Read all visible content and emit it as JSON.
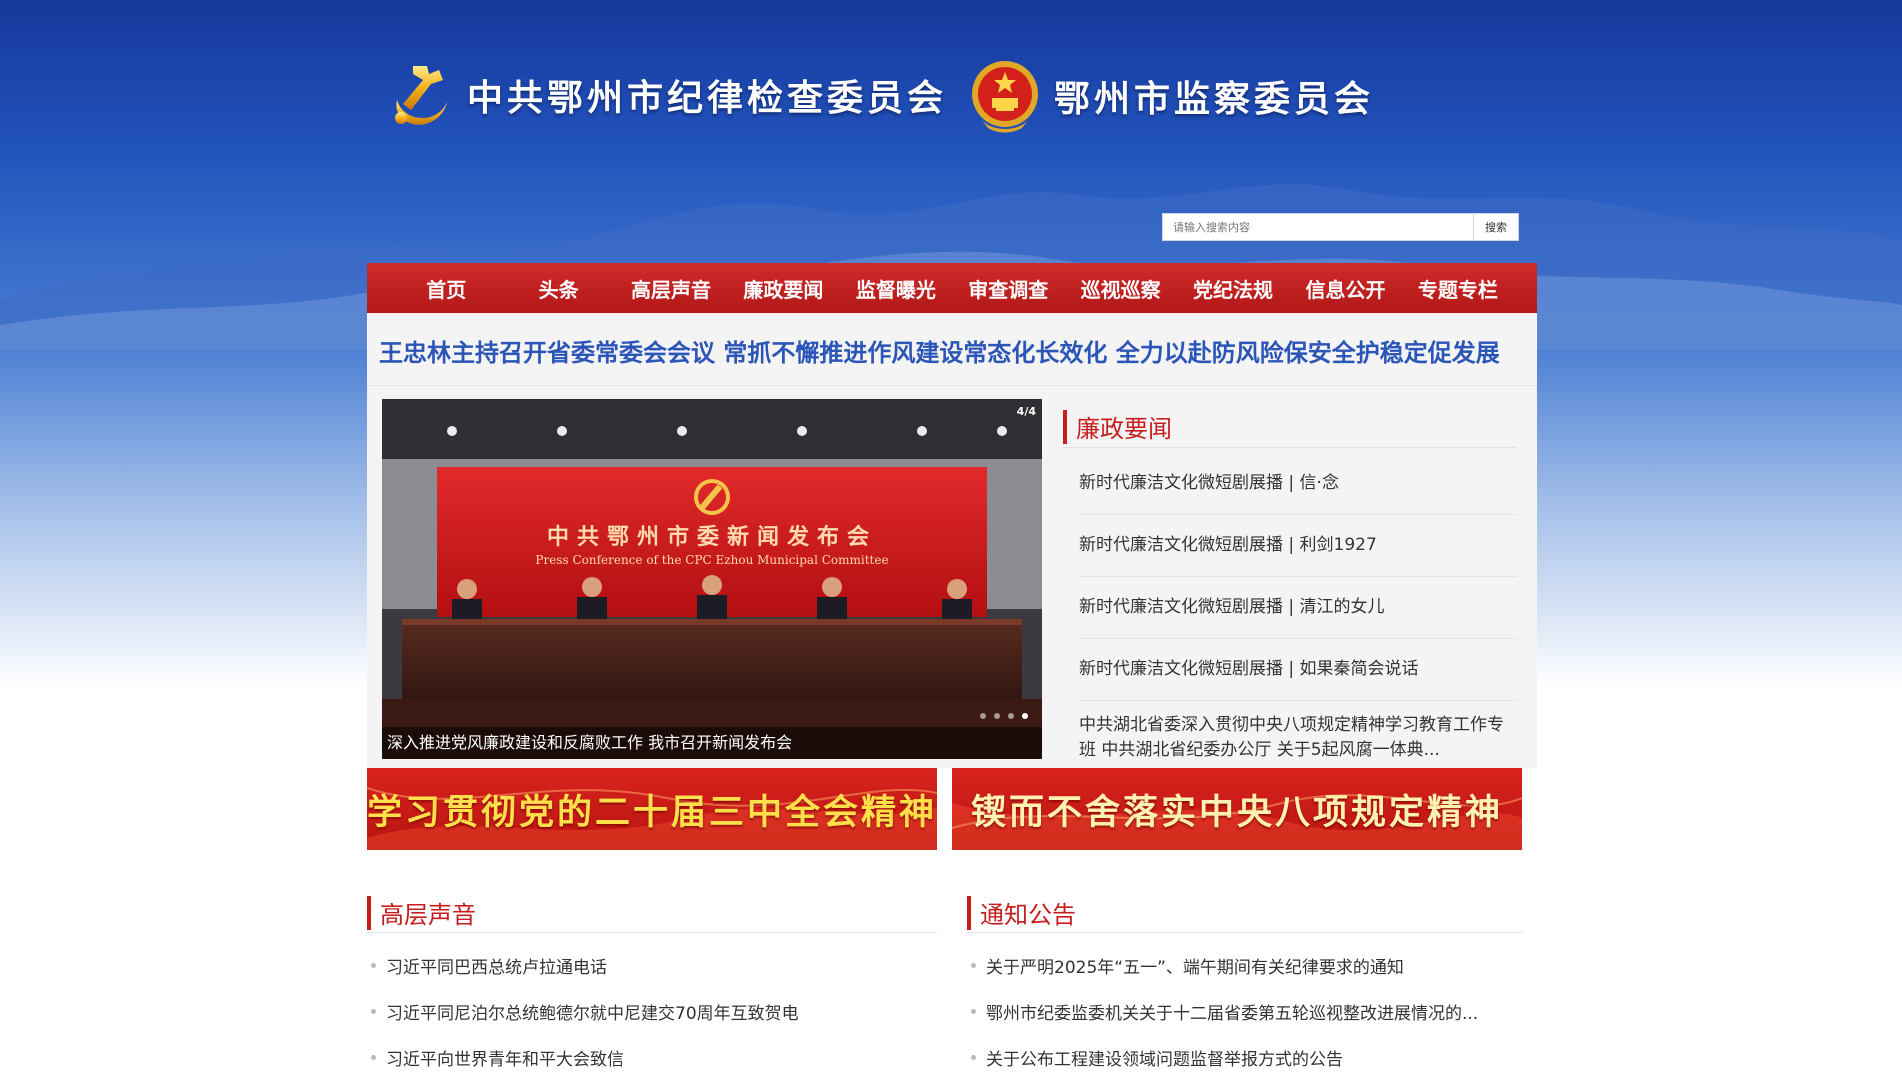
{
  "header": {
    "commission_name": "中共鄂州市纪律检查委员会",
    "supervision_name": "鄂州市监察委员会"
  },
  "search": {
    "placeholder": "请输入搜索内容",
    "button_label": "搜索"
  },
  "nav": {
    "items": [
      {
        "label": "首页"
      },
      {
        "label": "头条"
      },
      {
        "label": "高层声音"
      },
      {
        "label": "廉政要闻"
      },
      {
        "label": "监督曝光"
      },
      {
        "label": "审查调查"
      },
      {
        "label": "巡视巡察"
      },
      {
        "label": "党纪法规"
      },
      {
        "label": "信息公开"
      },
      {
        "label": "专题专栏"
      }
    ]
  },
  "headline": "王忠林主持召开省委常委会会议 常抓不懈推进作风建设常态化长效化 全力以赴防风险保安全护稳定促发展",
  "slider": {
    "counter": "4/4",
    "backdrop_title": "中共鄂州市委新闻发布会",
    "backdrop_subtitle": "Press Conference of the CPC Ezhou Municipal Committee",
    "caption": "深入推进党风廉政建设和反腐败工作 我市召开新闻发布会",
    "dot_count": 4,
    "active_dot": 4
  },
  "lianzheng": {
    "title": "廉政要闻",
    "items": [
      {
        "text": "新时代廉洁文化微短剧展播 | 信·念"
      },
      {
        "text": "新时代廉洁文化微短剧展播 | 利剑1927"
      },
      {
        "text": "新时代廉洁文化微短剧展播 | 清江的女儿"
      },
      {
        "text": "新时代廉洁文化微短剧展播 | 如果秦简会说话"
      },
      {
        "text": "中共湖北省委深入贯彻中央八项规定精神学习教育工作专班 中共湖北省纪委办公厅 关于5起风腐一体典..."
      }
    ]
  },
  "banners": {
    "left": "学习贯彻党的二十届三中全会精神",
    "right": "锲而不舍落实中央八项规定精神"
  },
  "gaoceng": {
    "title": "高层声音",
    "items": [
      {
        "text": "习近平同巴西总统卢拉通电话"
      },
      {
        "text": "习近平同尼泊尔总统鲍德尔就中尼建交70周年互致贺电"
      },
      {
        "text": "习近平向世界青年和平大会致信"
      }
    ]
  },
  "tongzhi": {
    "title": "通知公告",
    "items": [
      {
        "text": "关于严明2025年“五一”、端午期间有关纪律要求的通知"
      },
      {
        "text": "鄂州市纪委监委机关关于十二届省委第五轮巡视整改进展情况的..."
      },
      {
        "text": "关于公布工程建设领域问题监督举报方式的公告"
      }
    ]
  },
  "colors": {
    "nav_red": "#c21f1f",
    "title_red": "#c61e1e",
    "headline_blue": "#2c55b8",
    "banner_yellow": "#ffe04a"
  }
}
